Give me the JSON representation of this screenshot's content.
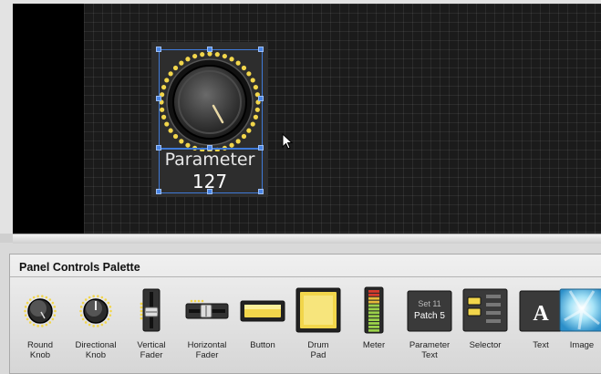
{
  "canvas": {
    "parameter_name": "Parameter",
    "parameter_value": "127"
  },
  "palette": {
    "title": "Panel Controls Palette",
    "items": [
      {
        "label": "Round\nKnob",
        "icon": "round-knob-icon"
      },
      {
        "label": "Directional\nKnob",
        "icon": "directional-knob-icon"
      },
      {
        "label": "Vertical\nFader",
        "icon": "vertical-fader-icon"
      },
      {
        "label": "Horizontal\nFader",
        "icon": "horizontal-fader-icon"
      },
      {
        "label": "Button",
        "icon": "button-icon"
      },
      {
        "label": "Drum\nPad",
        "icon": "drum-pad-icon"
      },
      {
        "label": "Meter",
        "icon": "meter-icon"
      },
      {
        "label": "Parameter\nText",
        "icon": "parameter-text-icon"
      },
      {
        "label": "Selector",
        "icon": "selector-icon"
      },
      {
        "label": "Text",
        "icon": "text-icon"
      },
      {
        "label": "Image",
        "icon": "image-icon"
      }
    ],
    "param_text_preview": {
      "line1": "Set 11",
      "line2": "Patch 5"
    },
    "text_preview_glyph": "A"
  },
  "colors": {
    "led": "#f2d64b",
    "selection": "#3f7ad8"
  }
}
